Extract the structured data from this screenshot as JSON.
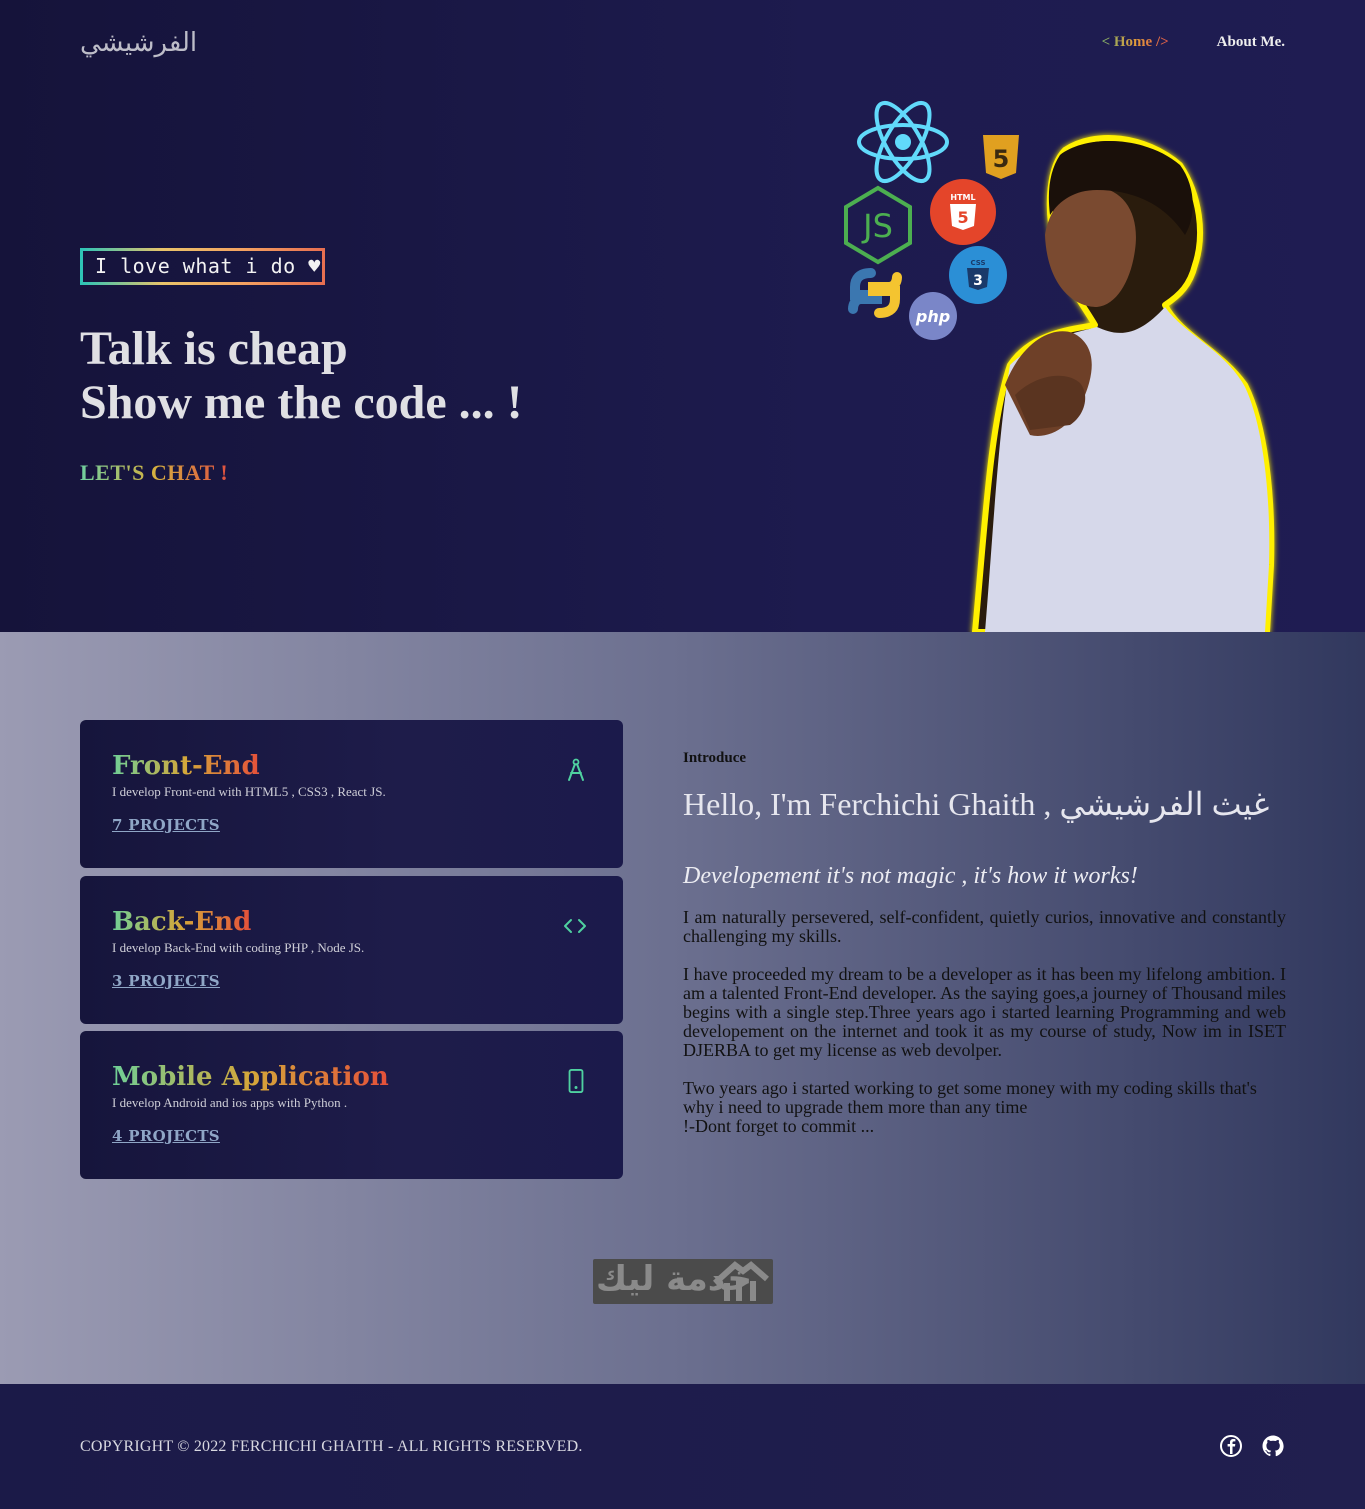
{
  "header": {
    "logo": "الفرشيشي",
    "nav": [
      {
        "prefix": "< ",
        "label": "Home",
        "suffix": " />"
      },
      {
        "label": "About Me."
      }
    ]
  },
  "hero": {
    "badge": "I love what i do ♥",
    "headline_line1": "Talk is cheap",
    "headline_line2": "Show me the code ... !",
    "cta": "LET'S CHAT !",
    "tech_icons": [
      "react-icon",
      "nodejs-icon",
      "html5-icon",
      "css3-icon",
      "python-icon",
      "php-icon",
      "html5-shield-icon"
    ],
    "php_label": "php",
    "html_label": "HTML",
    "css_label": "CSS"
  },
  "services": [
    {
      "title": "Front-End",
      "desc": "I develop Front-end with HTML5 , CSS3 , React JS.",
      "projects": "7 PROJECTS",
      "icon": "compass-icon"
    },
    {
      "title": "Back-End",
      "desc": "I develop Back-End with coding PHP , Node JS.",
      "projects": "3 PROJECTS",
      "icon": "code-icon"
    },
    {
      "title": "Mobile Application",
      "desc": "I develop Android and ios apps with Python .",
      "projects": "4 PROJECTS",
      "icon": "mobile-icon"
    }
  ],
  "intro": {
    "label": "Introduce",
    "hello": "Hello, I'm Ferchichi Ghaith , غيث الفرشيشي",
    "motto": "Developement it's not magic , it's how it works!",
    "p1": "I am naturally persevered, self-confident, quietly curios, innovative and constantly challenging my skills.",
    "p2": "I have proceeded my dream to be a developer as it has been my lifelong ambition. I am a talented Front-End developer. As the saying goes,a journey of Thousand miles begins with a single step.Three years ago i started learning Programming and web developement on the internet and took it as my course of study, Now im in ISET DJERBA to get my license as web devolper.",
    "p3_line1": "Two years ago i started working to get some money with my coding skills that's why i need to upgrade them more than any time",
    "p3_line2": "!-Dont forget to commit ..."
  },
  "stamp": {
    "text": "خدمة ليك"
  },
  "footer": {
    "copyright": "COPYRIGHT © 2022 FERCHICHI GHAITH - ALL RIGHTS RESERVED.",
    "social": [
      "facebook-icon",
      "github-icon"
    ]
  },
  "colors": {
    "hero_bg": "#1d1b4e",
    "card_bg": "#1e1c4a",
    "accent_green": "#6fcf97",
    "accent_orange": "#d4a73a",
    "accent_red": "#e5503a"
  }
}
